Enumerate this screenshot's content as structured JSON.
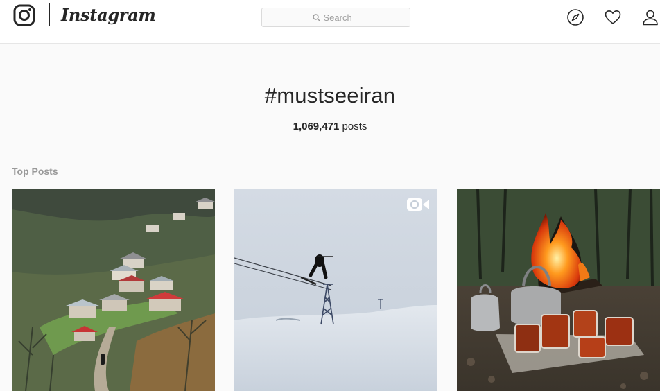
{
  "header": {
    "brand": "Instagram",
    "search_placeholder": "Search",
    "icons": [
      "instagram-camera-icon",
      "search-icon",
      "compass-icon",
      "heart-icon",
      "user-icon"
    ]
  },
  "hashtag": {
    "title": "#mustseeiran",
    "post_count": "1,069,471",
    "post_count_unit": "posts"
  },
  "top_posts": {
    "label": "Top Posts",
    "items": [
      {
        "subject": "village",
        "is_video": false
      },
      {
        "subject": "skier",
        "is_video": true,
        "badge_icon": "video-camera-icon"
      },
      {
        "subject": "tea-campfire",
        "is_video": false
      }
    ]
  },
  "colors": {
    "text": "#262626",
    "muted": "#999999",
    "border": "#dbdbdb",
    "background": "#fafafa"
  }
}
